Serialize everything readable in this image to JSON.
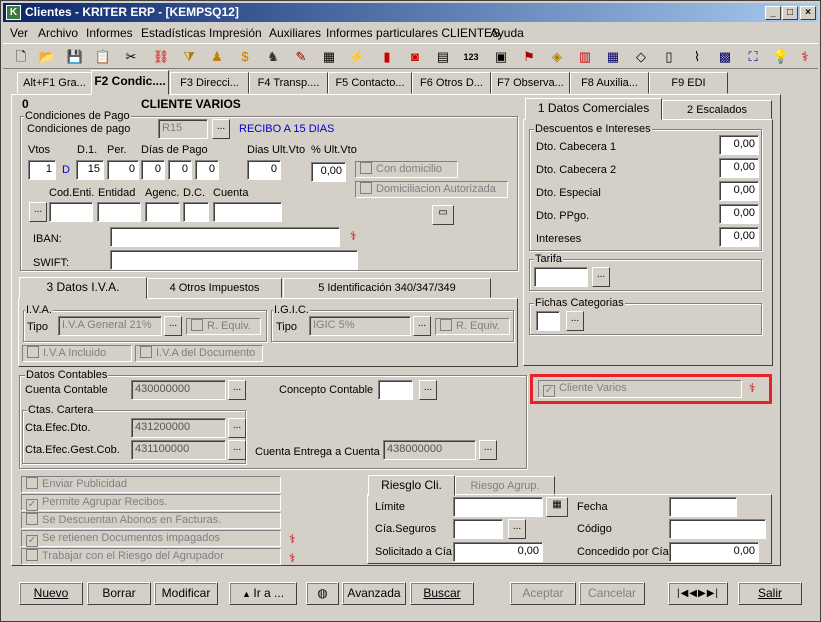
{
  "window": {
    "title": "Clientes - KRITER ERP - [KEMPSQ12]"
  },
  "menu": [
    "Ver",
    "Archivo",
    "Informes",
    "Estadísticas",
    "Impresión",
    "Auxiliares",
    "Informes particulares CLIENTES",
    "Ayuda"
  ],
  "tabs": [
    "Alt+F1 Gra...",
    "F2 Condic....",
    "F3 Direcci...",
    "F4 Transp....",
    "F5 Contacto...",
    "F6 Otros D...",
    "F7 Observa...",
    "F8 Auxilia...",
    "F9 EDI"
  ],
  "client": {
    "code": "0",
    "name": "CLIENTE VARIOS"
  },
  "condiciones": {
    "group_title": "Condiciones de Pago",
    "label": "Condiciones de pago",
    "code": "R15",
    "description": "RECIBO A 15 DIAS",
    "vtos_label": "Vtos",
    "vtos": "1",
    "d1_label": "D.1.",
    "d_marker": "D",
    "d1": "15",
    "per_label": "Per.",
    "per": "0",
    "dias_pago_label": "Días de Pago",
    "dias_pago": [
      "0",
      "0",
      "0"
    ],
    "dias_ult_label": "Dias Ult.Vto",
    "dias_ult": "0",
    "pct_ult_label": "% Ult.Vto",
    "pct_ult": "0,00",
    "con_domicilio": "Con domicilio",
    "domiciliacion": "Domiciliacion Autorizada",
    "cod_enti_label": "Cod.Enti.",
    "entidad_label": "Entidad",
    "agenc_label": "Agenc.",
    "dc_label": "D.C.",
    "cuenta_label": "Cuenta",
    "iban_label": "IBAN:",
    "swift_label": "SWIFT:"
  },
  "iva_tabs": [
    "3 Datos I.V.A.",
    "4 Otros Impuestos",
    "5 Identificación 340/347/349"
  ],
  "iva": {
    "title": "I.V.A.",
    "tipo_label": "Tipo",
    "tipo": "I.V.A General 21%",
    "requiv": "R. Equiv.",
    "incluido": "I.V.A Incluido",
    "del_doc": "I.V.A del Documento"
  },
  "igic": {
    "title": "I.G.I.C.",
    "tipo_label": "Tipo",
    "tipo": "IGIC 5%",
    "requiv": "R. Equiv."
  },
  "right_tabs": [
    "1 Datos Comerciales",
    "2 Escalados"
  ],
  "descuentos": {
    "title": "Descuentos e Intereses",
    "rows": [
      {
        "label": "Dto. Cabecera 1",
        "value": "0,00"
      },
      {
        "label": "Dto. Cabecera 2",
        "value": "0,00"
      },
      {
        "label": "Dto. Especial",
        "value": "0,00"
      },
      {
        "label": "Dto. PPgo.",
        "value": "0,00"
      },
      {
        "label": "Intereses",
        "value": "0,00"
      }
    ]
  },
  "tarifa": {
    "title": "Tarifa"
  },
  "fichas": {
    "title": "Fichas Categorias"
  },
  "cliente_varios": "Cliente Varios",
  "contables": {
    "title": "Datos Contables",
    "cuenta_label": "Cuenta Contable",
    "cuenta": "430000000",
    "concepto_label": "Concepto Contable",
    "cartera_title": "Ctas. Cartera",
    "efec_dto_label": "Cta.Efec.Dto.",
    "efec_dto": "431200000",
    "efec_gest_label": "Cta.Efec.Gest.Cob.",
    "efec_gest": "431100000",
    "entrega_label": "Cuenta Entrega a Cuenta",
    "entrega": "438000000"
  },
  "options": [
    {
      "label": "Enviar Publicidad",
      "checked": false
    },
    {
      "label": "Permite Agrupar Recibos.",
      "checked": true
    },
    {
      "label": "Se Descuentan Abonos en Facturas.",
      "checked": false
    },
    {
      "label": "Se retienen Documentos impagados",
      "checked": true
    },
    {
      "label": "Trabajar con el Riesgo del Agrupador",
      "checked": false
    }
  ],
  "riesgo_tabs": [
    "Riesglo Cli.",
    "Riesgo Agrup."
  ],
  "riesgo": {
    "limite_label": "Límite",
    "cia_label": "Cía.Seguros",
    "solicitado_label": "Solicitado a Cía",
    "solicitado": "0,00",
    "fecha_label": "Fecha",
    "codigo_label": "Código",
    "concedido_label": "Concedido por Cía",
    "concedido": "0,00"
  },
  "buttons": {
    "nuevo": "Nuevo",
    "borrar": "Borrar",
    "modificar": "Modificar",
    "ira": "Ir a ...",
    "avanzada": "Avanzada",
    "buscar": "Buscar",
    "aceptar": "Aceptar",
    "cancelar": "Cancelar",
    "salir": "Salir"
  },
  "colors": {
    "titlebar": "#0a246a",
    "highlight": "#e8202a",
    "link_blue": "#0000cc"
  }
}
